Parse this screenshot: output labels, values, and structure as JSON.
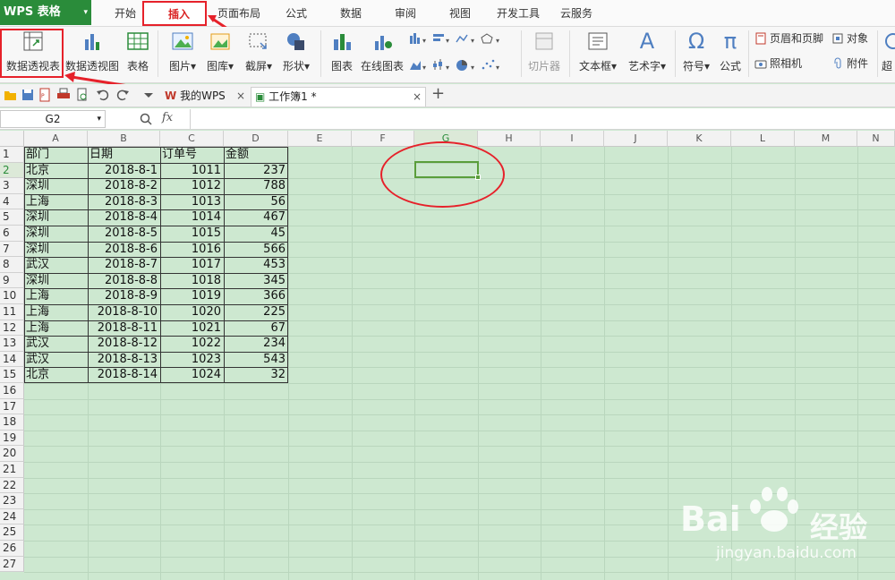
{
  "app": {
    "name": "WPS 表格"
  },
  "menu": {
    "tabs": [
      "开始",
      "插入",
      "页面布局",
      "公式",
      "数据",
      "审阅",
      "视图",
      "开发工具",
      "云服务"
    ],
    "active_tab": "插入"
  },
  "ribbon": {
    "pivot_table": "数据透视表",
    "pivot_chart": "数据透视图",
    "table": "表格",
    "picture": "图片",
    "gallery": "图库",
    "screenshot": "截屏",
    "shape": "形状",
    "chart": "图表",
    "online_chart": "在线图表",
    "slicer": "切片器",
    "textbox": "文本框",
    "wordart": "艺术字",
    "symbol": "符号",
    "formula": "公式",
    "header_footer": "页眉和页脚",
    "object": "对象",
    "camera": "照相机",
    "attachment": "附件",
    "hyperlink_partial": "超",
    "omega_glyph": "Ω",
    "pi_glyph": "π",
    "wordart_glyph": "A"
  },
  "doc_tabs": {
    "home_tab": "我的WPS",
    "workbook_tab": "工作簿1 *",
    "close_glyph": "×",
    "add_glyph": "+"
  },
  "formula_bar": {
    "name_box": "G2",
    "fx_label": "fx",
    "value": ""
  },
  "sheet": {
    "columns": [
      "A",
      "B",
      "C",
      "D",
      "E",
      "F",
      "G",
      "H",
      "I",
      "J",
      "K",
      "L",
      "M",
      "N"
    ],
    "row_numbers": [
      "1",
      "2",
      "3",
      "4",
      "5",
      "6",
      "7",
      "8",
      "9",
      "10",
      "11",
      "12",
      "13",
      "14",
      "15",
      "16",
      "17",
      "18",
      "19",
      "20",
      "21",
      "22",
      "23",
      "24",
      "25",
      "26",
      "27"
    ],
    "headers": [
      "部门",
      "日期",
      "订单号",
      "金额"
    ],
    "rows": [
      [
        "北京",
        "2018-8-1",
        "1011",
        "237"
      ],
      [
        "深圳",
        "2018-8-2",
        "1012",
        "788"
      ],
      [
        "上海",
        "2018-8-3",
        "1013",
        "56"
      ],
      [
        "深圳",
        "2018-8-4",
        "1014",
        "467"
      ],
      [
        "深圳",
        "2018-8-5",
        "1015",
        "45"
      ],
      [
        "深圳",
        "2018-8-6",
        "1016",
        "566"
      ],
      [
        "武汉",
        "2018-8-7",
        "1017",
        "453"
      ],
      [
        "深圳",
        "2018-8-8",
        "1018",
        "345"
      ],
      [
        "上海",
        "2018-8-9",
        "1019",
        "366"
      ],
      [
        "上海",
        "2018-8-10",
        "1020",
        "225"
      ],
      [
        "上海",
        "2018-8-11",
        "1021",
        "67"
      ],
      [
        "武汉",
        "2018-8-12",
        "1022",
        "234"
      ],
      [
        "武汉",
        "2018-8-13",
        "1023",
        "543"
      ],
      [
        "北京",
        "2018-8-14",
        "1024",
        "32"
      ]
    ],
    "selected_cell": "G2"
  },
  "watermark": {
    "brand": "Bai",
    "brand_cn": "经验",
    "url": "jingyan.baidu.com"
  },
  "colors": {
    "accent_green": "#2a8c3a",
    "annotation_red": "#e6212a",
    "sheet_bg": "#cde8d0"
  }
}
